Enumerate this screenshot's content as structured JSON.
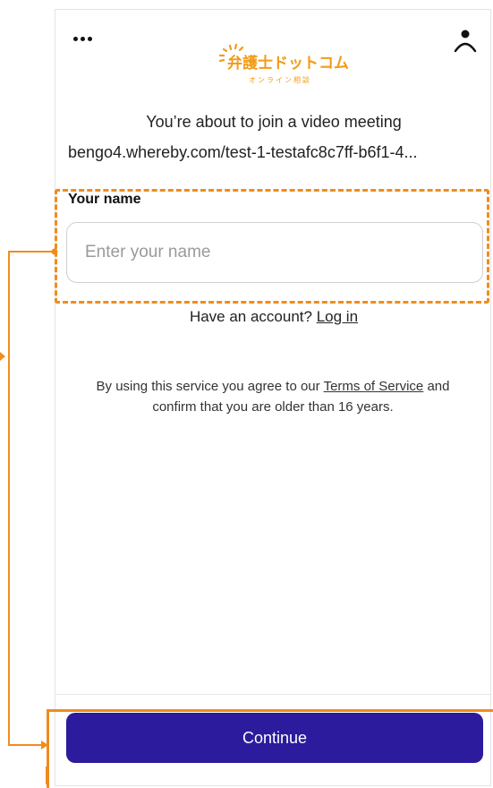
{
  "header": {
    "menu_icon": "more-dots-icon",
    "user_icon": "user-icon",
    "logo": {
      "main_text": "弁護士ドットコム",
      "sub_text": "オンライン相談",
      "color": "#f29b18"
    }
  },
  "meeting": {
    "intro_text": "You’re about to join a video meeting",
    "room_url": "bengo4.whereby.com/test-1-testafc8c7ff-b6f1-4..."
  },
  "name_form": {
    "label": "Your name",
    "placeholder": "Enter your name",
    "value": ""
  },
  "account": {
    "prompt": "Have an account?",
    "login_link": "Log in"
  },
  "terms": {
    "prefix": "By using this service you agree to our",
    "link": "Terms of Service",
    "suffix": "and confirm that you are older than 16 years."
  },
  "actions": {
    "continue_label": "Continue"
  },
  "colors": {
    "accent_button": "#2c1b9c",
    "annotation": "#f08c1e"
  }
}
